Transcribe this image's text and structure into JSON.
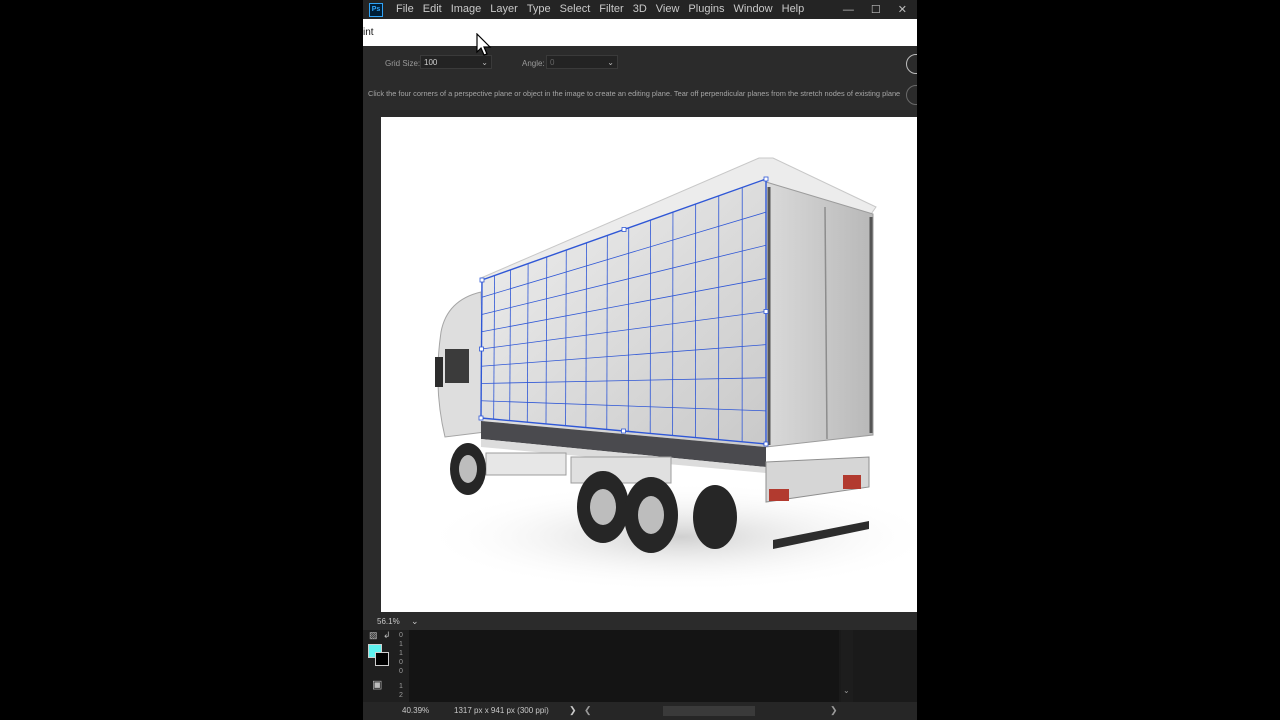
{
  "app": {
    "logo": "Ps",
    "menu": [
      "File",
      "Edit",
      "Image",
      "Layer",
      "Type",
      "Select",
      "Filter",
      "3D",
      "View",
      "Plugins",
      "Window",
      "Help"
    ],
    "window_controls": [
      "—",
      "☐",
      "✕"
    ]
  },
  "dialog": {
    "title": "int"
  },
  "options": {
    "grid_size_label": "Grid Size:",
    "grid_size_value": "100",
    "angle_label": "Angle:",
    "angle_value": "0"
  },
  "instruction": {
    "text": "Click the four corners of a perspective plane or object in the image to create an editing plane. Tear off perpendicular planes from the stretch nodes of existing plane"
  },
  "zoom": {
    "value": "56.1%"
  },
  "panel": {
    "ruler_digits": [
      "0",
      "1",
      "1",
      "0",
      "0"
    ],
    "ruler_digits_lower": [
      "1",
      "2"
    ],
    "fg_color": "#5ff2ef",
    "bg_color": "#000000"
  },
  "status": {
    "zoom": "40.39%",
    "document_size": "1317 px x 941 px (300 ppi)"
  },
  "icons": {
    "swap_colors": "swap-arrow-icon",
    "default_colors": "default-colors-icon",
    "quick_mask": "quick-mask-icon",
    "screen_mode": "screen-mode-icon",
    "cursor": "mouse-pointer-icon"
  }
}
